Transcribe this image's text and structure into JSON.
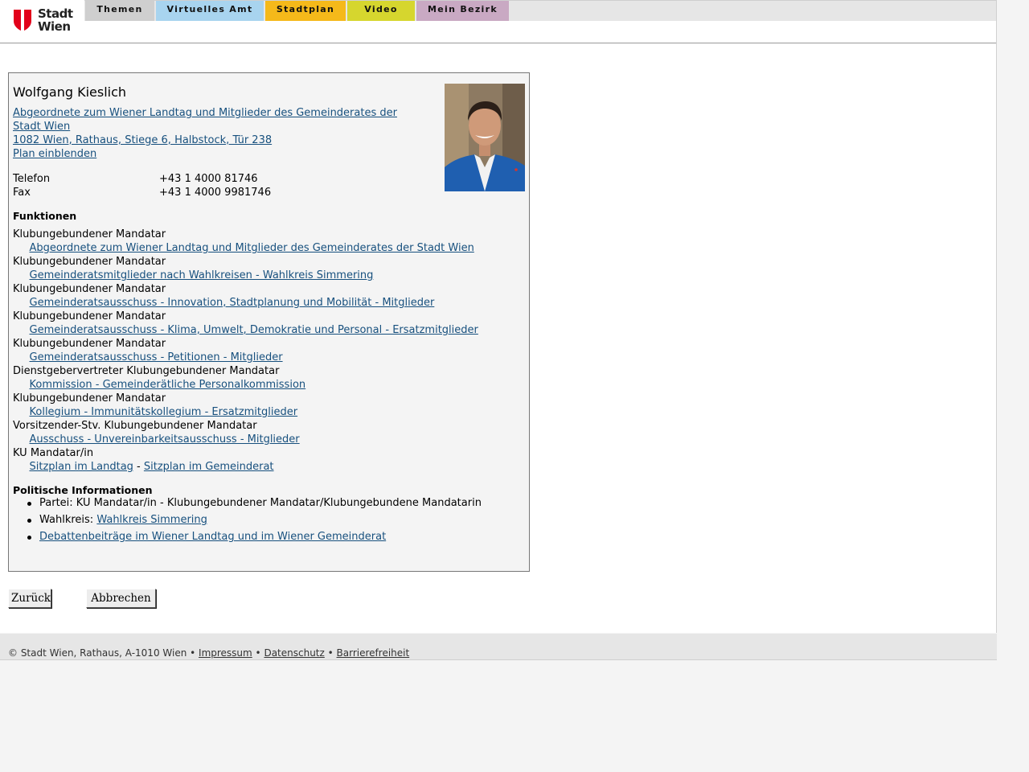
{
  "logo": {
    "line1": "Stadt",
    "line2": "Wien",
    "color": "#e2001a"
  },
  "nav": {
    "tabs": [
      {
        "label": "Themen",
        "color": "#cfcfcf"
      },
      {
        "label": "Virtuelles Amt",
        "color": "#a8d4ef"
      },
      {
        "label": "Stadtplan",
        "color": "#f5b91a"
      },
      {
        "label": "Video",
        "color": "#d6d62e"
      },
      {
        "label": "Mein Bezirk",
        "color": "#c9a9c3"
      }
    ]
  },
  "person": {
    "name": "Wolfgang Kieslich",
    "org_line1": "Abgeordnete zum Wiener Landtag und Mitglieder des Gemeinderates der",
    "org_line2": "Stadt Wien ",
    "address": "1082 Wien, Rathaus, Stiege 6, Halbstock, Tür 238",
    "plan_link": "Plan einblenden",
    "phone_label": "Telefon",
    "phone": "+43 1 4000 81746",
    "fax_label": "Fax",
    "fax": "+43 1 4000 9981746"
  },
  "functions": {
    "title": "Funktionen",
    "items": [
      {
        "role": "Klubungebundener Mandatar",
        "link": "Abgeordnete zum Wiener Landtag und Mitglieder des Gemeinderates der Stadt Wien"
      },
      {
        "role": "Klubungebundener Mandatar",
        "link": "Gemeinderatsmitglieder nach Wahlkreisen - Wahlkreis Simmering"
      },
      {
        "role": "Klubungebundener Mandatar",
        "link": "Gemeinderatsausschuss - Innovation, Stadtplanung und Mobilität - Mitglieder"
      },
      {
        "role": "Klubungebundener Mandatar",
        "link": "Gemeinderatsausschuss - Klima, Umwelt, Demokratie und Personal - Ersatzmitglieder"
      },
      {
        "role": "Klubungebundener Mandatar",
        "link": "Gemeinderatsausschuss - Petitionen - Mitglieder"
      },
      {
        "role": "Dienstgebervertreter Klubungebundener Mandatar",
        "link": "Kommission - Gemeinderätliche Personalkommission"
      },
      {
        "role": "Klubungebundener Mandatar",
        "link": "Kollegium - Immunitätskollegium - Ersatzmitglieder"
      },
      {
        "role": "Vorsitzender-Stv. Klubungebundener Mandatar",
        "link": "Ausschuss - Unvereinbarkeitsausschuss - Mitglieder"
      }
    ],
    "last_role": "KU Mandatar/in",
    "seat_landtag": "Sitzplan im Landtag",
    "seat_sep": " - ",
    "seat_gemeinderat": "Sitzplan im Gemeinderat"
  },
  "political": {
    "title": "Politische Informationen",
    "party": "Partei: KU Mandatar/in - Klubungebundener Mandatar/Klubungebundene Mandatarin",
    "district_label": "Wahlkreis: ",
    "district_link": "Wahlkreis Simmering",
    "debates_link": "Debattenbeiträge im Wiener Landtag und im Wiener Gemeinderat"
  },
  "buttons": {
    "back": "Zurück",
    "cancel": "Abbrechen"
  },
  "footer": {
    "copyright": "© Stadt Wien, Rathaus, A-1010 Wien",
    "sep": " • ",
    "impressum": "Impressum",
    "datenschutz": "Datenschutz",
    "barrierefreiheit": "Barrierefreiheit"
  }
}
